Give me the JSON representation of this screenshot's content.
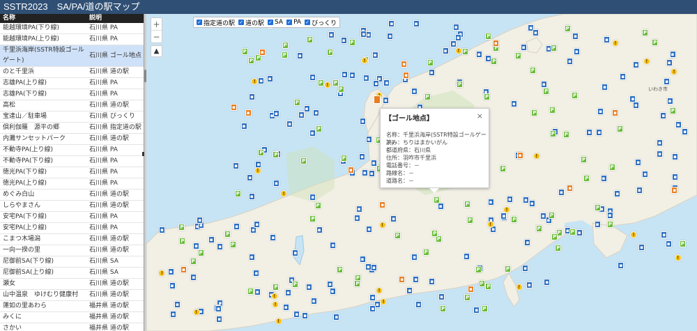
{
  "title": "SSTR2023　SA/PA/道の駅マップ",
  "table": {
    "headers": [
      "名称",
      "説明"
    ],
    "selected_index": 2,
    "rows": [
      [
        "能越環境PA(下り線)",
        "石川県 PA"
      ],
      [
        "能越環境PA(上り線)",
        "石川県 PA"
      ],
      [
        "千里浜海岸(SSTR特設ゴールゲート)",
        "石川県 ゴール地点"
      ],
      [
        "のと千里浜",
        "石川県 道の駅"
      ],
      [
        "志雄PA(上り線)",
        "石川県 PA"
      ],
      [
        "志雄PA(下り線)",
        "石川県 PA"
      ],
      [
        "高松",
        "石川県 道の駅"
      ],
      [
        "宝達山／駐車場",
        "石川県 びっくり"
      ],
      [
        "倶利伽羅　源平の郷",
        "石川県 指定道の駅"
      ],
      [
        "内灘サンセットパーク",
        "石川県 道の駅"
      ],
      [
        "不動寺PA(上り線)",
        "石川県 PA"
      ],
      [
        "不動寺PA(下り線)",
        "石川県 PA"
      ],
      [
        "徳光PA(下り線)",
        "石川県 PA"
      ],
      [
        "徳光PA(上り線)",
        "石川県 PA"
      ],
      [
        "めぐみ白山",
        "石川県 道の駅"
      ],
      [
        "しらやまさん",
        "石川県 道の駅"
      ],
      [
        "安宅PA(下り線)",
        "石川県 PA"
      ],
      [
        "安宅PA(上り線)",
        "石川県 PA"
      ],
      [
        "こまつ木場潟",
        "石川県 道の駅"
      ],
      [
        "一向一揆の里",
        "石川県 道の駅"
      ],
      [
        "尼御前SA(下り線)",
        "石川県 SA"
      ],
      [
        "尼御前SA(上り線)",
        "石川県 SA"
      ],
      [
        "瀬女",
        "石川県 道の駅"
      ],
      [
        "山中温泉　ゆけむり健康村",
        "石川県 道の駅"
      ],
      [
        "蓮如の里あわら",
        "福井県 道の駅"
      ],
      [
        "みくに",
        "福井県 道の駅"
      ],
      [
        "さかい",
        "福井県 道の駅"
      ]
    ]
  },
  "layers": [
    {
      "label": "指定道の駅",
      "checked": true
    },
    {
      "label": "道の駅",
      "checked": true
    },
    {
      "label": "SA",
      "checked": true
    },
    {
      "label": "PA",
      "checked": true
    },
    {
      "label": "びっくり",
      "checked": true
    }
  ],
  "map": {
    "zoom_in": "+",
    "zoom_out": "−",
    "compass": "▲",
    "marker_colors": {
      "michinoeki": "#2d6fbf",
      "sa_pa": "#6bbb3a",
      "bikkuri": "#f3c316",
      "shitei": "#e67e22"
    },
    "place_labels": [
      "いわき市"
    ]
  },
  "popup": {
    "title": "【ゴール地点】",
    "close": "×",
    "lines": [
      "名称：千里浜海岸(SSTR特設ゴールゲート)",
      "読み：ちりはまかいがん",
      "都道府県：石川県",
      "住所：羽咋市千里浜",
      "電話番号：－",
      "路線名：－",
      "道路名：－"
    ]
  }
}
